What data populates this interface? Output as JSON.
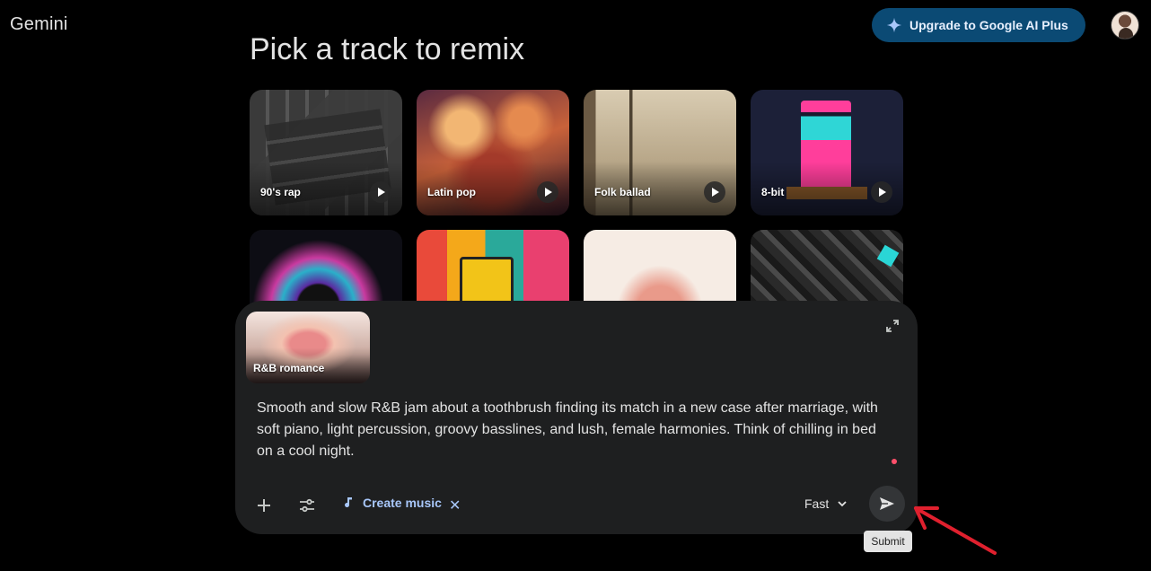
{
  "app": {
    "title": "Gemini"
  },
  "header": {
    "upgrade_label": "Upgrade to Google AI Plus",
    "avatar_icon": "user-avatar"
  },
  "section": {
    "title": "Pick a track to remix"
  },
  "tracks": [
    {
      "label": "90's rap"
    },
    {
      "label": "Latin pop"
    },
    {
      "label": "Folk ballad"
    },
    {
      "label": "8-bit"
    }
  ],
  "composer": {
    "attachment_label": "R&B romance",
    "prompt_text": "Smooth and slow R&B jam about a toothbrush finding its match in a new case after marriage, with soft piano, light percussion, groovy basslines, and lush, female harmonies. Think of chilling in bed on a cool night.",
    "tool_chip_label": "Create music",
    "mode_label": "Fast",
    "submit_tooltip": "Submit"
  },
  "colors": {
    "accent": "#a8c7fa",
    "upgrade_bg": "#0b4a74",
    "annotation_arrow": "#e0202e",
    "record_dot": "#ff4f6a"
  }
}
